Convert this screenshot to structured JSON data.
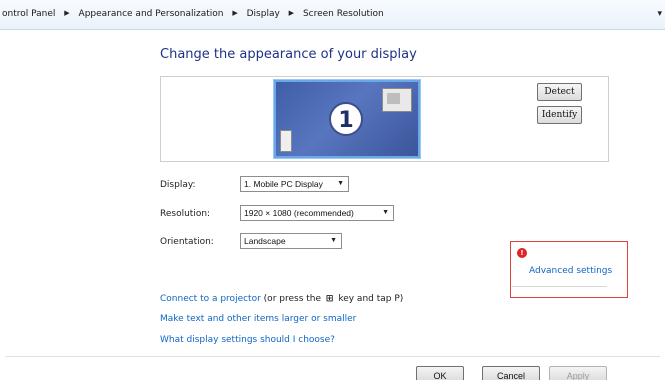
{
  "breadcrumb": {
    "items": [
      "ontrol Panel",
      "Appearance and Personalization",
      "Display",
      "Screen Resolution"
    ],
    "separator": "▶"
  },
  "page": {
    "title": "Change the appearance of your display"
  },
  "preview": {
    "monitor_number": "1",
    "detect_label": "Detect",
    "identify_label": "Identify"
  },
  "settings": {
    "display": {
      "label": "Display:",
      "value": "1. Mobile PC Display"
    },
    "resolution": {
      "label": "Resolution:",
      "value": "1920 × 1080 (recommended)"
    },
    "orientation": {
      "label": "Orientation:",
      "value": "Landscape"
    }
  },
  "advanced": {
    "badge": "!",
    "label": "Advanced settings"
  },
  "links": {
    "projector_link": "Connect to a projector",
    "projector_rest_before": "(or press the",
    "projector_rest_after": "key and tap P)",
    "windows_key_icon": "windows-logo",
    "text_size": "Make text and other items larger or smaller",
    "help": "What display settings should I choose?"
  },
  "actions": {
    "ok": "OK",
    "cancel": "Cancel",
    "apply": "Apply"
  },
  "colors": {
    "title": "#1e3287",
    "link": "#0f66c6",
    "highlight": "#e23f3f"
  }
}
